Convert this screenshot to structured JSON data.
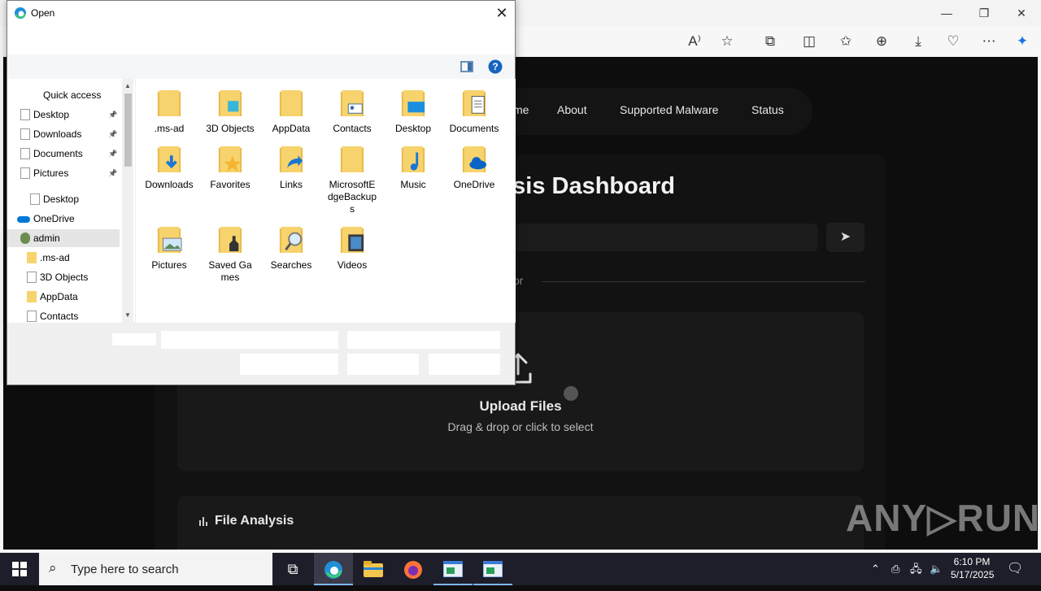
{
  "browser": {
    "window_controls": {
      "minimize": "—",
      "restore": "❐",
      "close": "✕"
    },
    "toolbar_icons": [
      "read-aloud-icon",
      "favorite-star-icon",
      "extensions-icon",
      "split-screen-icon",
      "favorites-icon",
      "collections-icon",
      "downloads-icon",
      "browser-essentials-icon",
      "more-icon",
      "copilot-icon"
    ]
  },
  "site": {
    "nav": {
      "home": "me",
      "about": "About",
      "supported_malware": "Supported Malware",
      "status": "Status"
    },
    "dashboard_title": "ysis Dashboard",
    "or_text": "or",
    "upload_title": "Upload Files",
    "upload_subtitle": "Drag & drop or click to select",
    "file_analysis_title": "File Analysis",
    "watermark": "ANY▷RUN"
  },
  "dialog": {
    "title": "Open",
    "close": "✕",
    "nav_pane": [
      {
        "label": "Quick access",
        "icon": "star-icon"
      },
      {
        "label": "Desktop",
        "icon": "desktop-icon",
        "pinned": true
      },
      {
        "label": "Downloads",
        "icon": "downloads-icon",
        "pinned": true
      },
      {
        "label": "Documents",
        "icon": "documents-icon",
        "pinned": true
      },
      {
        "label": "Pictures",
        "icon": "pictures-icon",
        "pinned": true
      },
      {
        "label": "Desktop",
        "icon": "desktop-icon"
      },
      {
        "label": "OneDrive",
        "icon": "onedrive-icon"
      },
      {
        "label": "admin",
        "icon": "user-icon",
        "selected": true
      },
      {
        "label": ".ms-ad",
        "icon": "folder-icon"
      },
      {
        "label": "3D Objects",
        "icon": "3d-objects-icon"
      },
      {
        "label": "AppData",
        "icon": "folder-icon"
      },
      {
        "label": "Contacts",
        "icon": "contacts-icon"
      }
    ],
    "files": [
      {
        "label": ".ms-ad",
        "icon": "folder-icon"
      },
      {
        "label": "3D Objects",
        "icon": "3d-objects-folder-icon"
      },
      {
        "label": "AppData",
        "icon": "folder-icon"
      },
      {
        "label": "Contacts",
        "icon": "contacts-folder-icon"
      },
      {
        "label": "Desktop",
        "icon": "desktop-folder-icon"
      },
      {
        "label": "Documents",
        "icon": "documents-folder-icon"
      },
      {
        "label": "Downloads",
        "icon": "downloads-folder-icon"
      },
      {
        "label": "Favorites",
        "icon": "favorites-folder-icon"
      },
      {
        "label": "Links",
        "icon": "links-folder-icon"
      },
      {
        "label": "MicrosoftEdgeBackups",
        "icon": "folder-icon"
      },
      {
        "label": "Music",
        "icon": "music-folder-icon"
      },
      {
        "label": "OneDrive",
        "icon": "onedrive-folder-icon"
      },
      {
        "label": "Pictures",
        "icon": "pictures-folder-icon"
      },
      {
        "label": "Saved Games",
        "icon": "saved-games-folder-icon"
      },
      {
        "label": "Searches",
        "icon": "searches-folder-icon"
      },
      {
        "label": "Videos",
        "icon": "videos-folder-icon"
      }
    ]
  },
  "taskbar": {
    "search_placeholder": "Type here to search",
    "time": "6:10 PM",
    "date": "5/17/2025"
  },
  "colors": {
    "folder": "#f6d36c",
    "folder_dark": "#e8b94a",
    "accent_blue": "#0078d4",
    "selected_bg": "#e5e5e5"
  }
}
